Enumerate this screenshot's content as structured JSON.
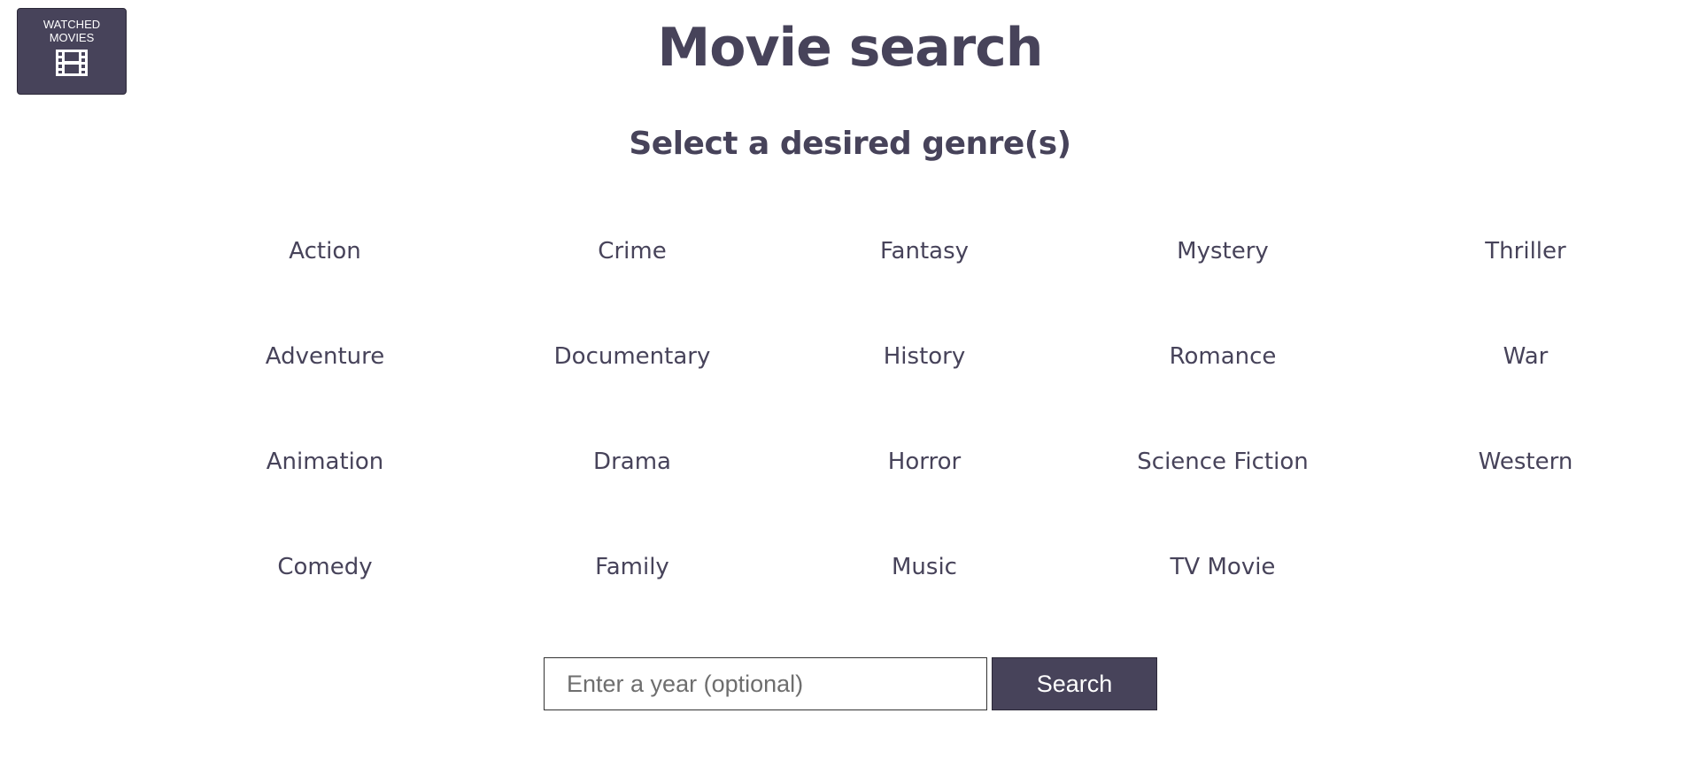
{
  "watched_button": {
    "label": "WATCHED MOVIES",
    "icon": "film-icon"
  },
  "header": {
    "title": "Movie search",
    "subtitle": "Select a desired genre(s)"
  },
  "genres": [
    "Action",
    "Crime",
    "Fantasy",
    "Mystery",
    "Thriller",
    "Adventure",
    "Documentary",
    "History",
    "Romance",
    "War",
    "Animation",
    "Drama",
    "Horror",
    "Science Fiction",
    "Western",
    "Comedy",
    "Family",
    "Music",
    "TV Movie"
  ],
  "search": {
    "placeholder": "Enter a year (optional)",
    "value": "",
    "button_label": "Search"
  },
  "colors": {
    "primary": "#47435a",
    "background": "#ffffff",
    "button_text": "#ffffff"
  }
}
